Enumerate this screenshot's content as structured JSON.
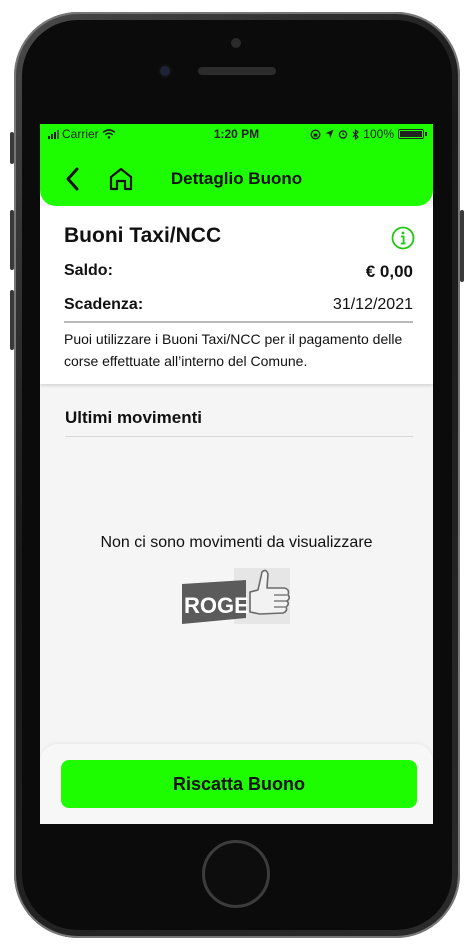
{
  "status_bar": {
    "carrier": "Carrier",
    "time": "1:20 PM",
    "battery": "100%"
  },
  "nav": {
    "title": "Dettaglio Buono",
    "back_icon": "chevron-left-icon",
    "home_icon": "home-icon"
  },
  "card": {
    "title": "Buoni Taxi/NCC",
    "info_icon": "info-icon",
    "saldo_label": "Saldo:",
    "saldo_value": "€ 0,00",
    "scadenza_label": "Scadenza:",
    "scadenza_value": "31/12/2021",
    "description": "Puoi utilizzare i Buoni Taxi/NCC per il pagamento delle corse effettuate all’interno del Comune."
  },
  "movements": {
    "title": "Ultimi movimenti",
    "empty_text": "Non ci sono movimenti da visualizzare",
    "logo_text": "ROGER"
  },
  "footer": {
    "cta_label": "Riscatta Buono"
  },
  "colors": {
    "accent": "#1efd00",
    "background": "#f5f5f5",
    "card": "#ffffff"
  }
}
